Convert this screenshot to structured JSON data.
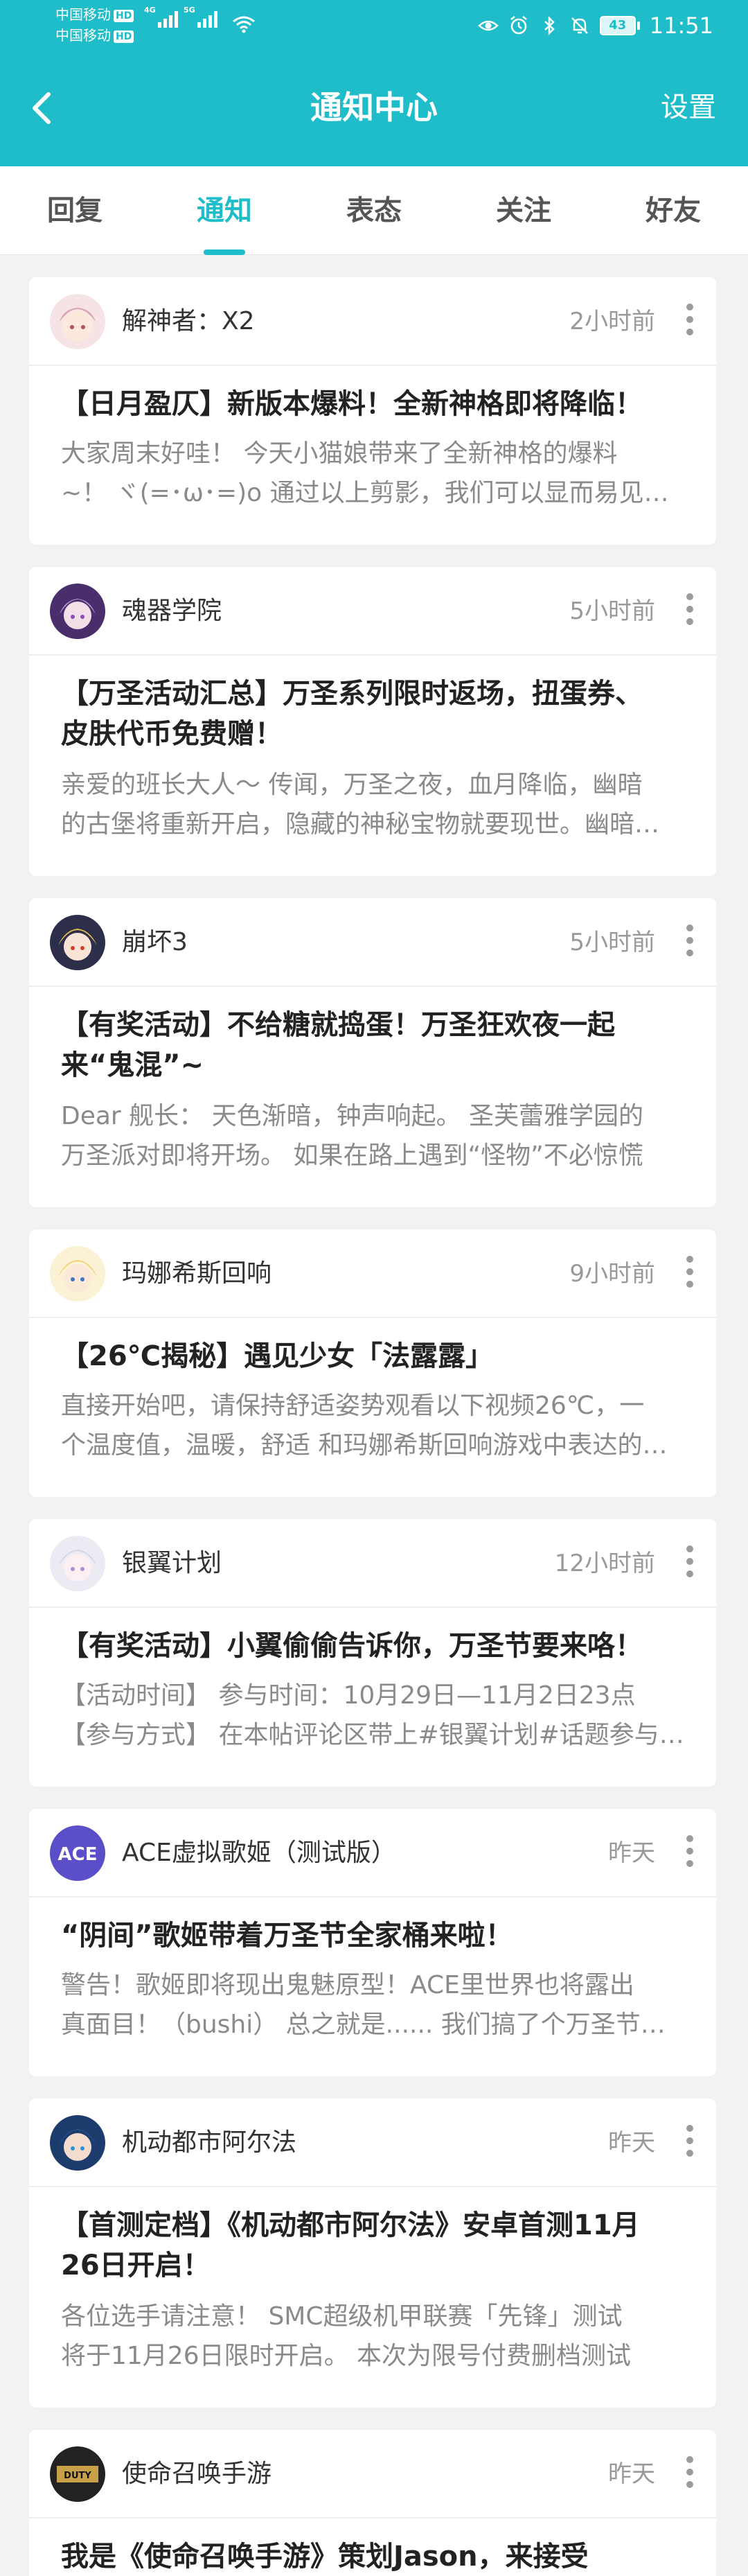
{
  "status_bar": {
    "carrier1": "中国移动",
    "carrier2": "中国移动",
    "hd": "HD",
    "net1": "4G",
    "net2": "5G",
    "battery": "43",
    "time": "11:51"
  },
  "header": {
    "title": "通知中心",
    "settings": "设置",
    "back_icon": "back-arrow-icon",
    "color": "#1fbcc9"
  },
  "tabs": [
    {
      "label": "回复",
      "active": false
    },
    {
      "label": "通知",
      "active": true
    },
    {
      "label": "表态",
      "active": false
    },
    {
      "label": "关注",
      "active": false
    },
    {
      "label": "好友",
      "active": false
    }
  ],
  "cards": [
    {
      "author": "解神者：X2",
      "time": "2小时前",
      "title": "【日月盈仄】新版本爆料！全新神格即将降临！",
      "body1": "大家周末好哇！ 今天小猫娘带来了全新神格的爆料",
      "body2": "~！ ヾ(=･ω･=)o 通过以上剪影，我们可以显而易见的看出"
    },
    {
      "author": "魂器学院",
      "time": "5小时前",
      "title1": "【万圣活动汇总】万圣系列限时返场，扭蛋券、",
      "title2": "皮肤代币免费赠！",
      "body1": "亲爱的班长大人～ 传闻，万圣之夜，血月降临，幽暗",
      "body2": "的古堡将重新开启，隐藏的神秘宝物就要现世。幽暗的古堡"
    },
    {
      "author": "崩坏3",
      "time": "5小时前",
      "title1": "【有奖活动】不给糖就捣蛋！万圣狂欢夜一起",
      "title2": "来“鬼混”~",
      "body1": "Dear 舰长： 天色渐暗，钟声响起。 圣芙蕾雅学园的",
      "body2": "万圣派对即将开场。 如果在路上遇到“怪物”不必惊慌"
    },
    {
      "author": "玛娜希斯回响",
      "time": "9小时前",
      "title": "【26℃揭秘】遇见少女「法露露」",
      "body1": "直接开始吧，请保持舒适姿势观看以下视频26℃，一",
      "body2": "个温度值，温暖，舒适 和玛娜希斯回响游戏中表达的情感"
    },
    {
      "author": "银翼计划",
      "time": "12小时前",
      "title": "【有奖活动】小翼偷偷告诉你，万圣节要来咯！",
      "body1": "【活动时间】 参与时间：10月29日—11月2日23点",
      "body2": "【参与方式】 在本帖评论区带上#银翼计划#话题参与活动"
    },
    {
      "author": "ACE虚拟歌姬（测试版）",
      "time": "昨天",
      "title": "“阴间”歌姬带着万圣节全家桶来啦！",
      "body1": "警告！歌姬即将现出鬼魅原型！ACE里世界也将露出",
      "body2": "真面目！（bushi） 总之就是...... 我们搞了个万圣节活动"
    },
    {
      "author": "机动都市阿尔法",
      "time": "昨天",
      "title1": "【首测定档】《机动都市阿尔法》安卓首测11月",
      "title2": "26日开启！",
      "body1": "各位选手请注意！ SMC超级机甲联赛「先锋」测试",
      "body2": "将于11月26日限时开启。 本次为限号付费删档测试"
    },
    {
      "author": "使命召唤手游",
      "time": "昨天",
      "title1": "我是《使命召唤手游》策划Jason，来接受"
    }
  ]
}
